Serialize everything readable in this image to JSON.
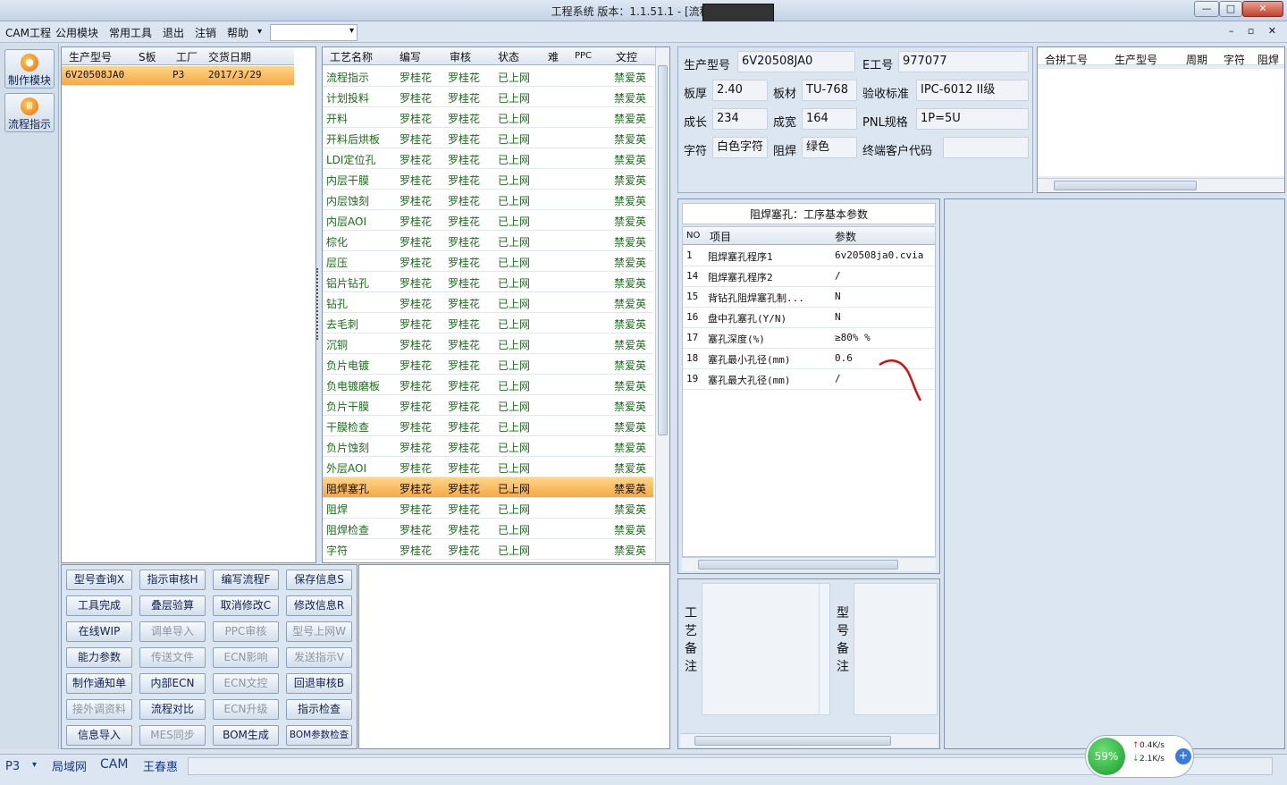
{
  "window": {
    "title": "工程系统    版本：1.1.51.1 - [流程指示]",
    "btn_minimize": "—",
    "btn_maximize": "□",
    "btn_close": "✕"
  },
  "menu": {
    "items": [
      "CAM工程",
      "公用模块",
      "常用工具",
      "退出",
      "注销",
      "帮助"
    ],
    "help_arrow": "▾",
    "mdi_controls": "– ▫ ✕"
  },
  "sidebar": {
    "buttons": [
      {
        "label": "制作模块"
      },
      {
        "label": "流程指示"
      }
    ]
  },
  "product_list": {
    "columns": [
      "生产型号",
      "S板",
      "工厂",
      "交货日期"
    ],
    "rows": [
      {
        "model": "6V20508JA0",
        "s": "",
        "factory": "P3",
        "date": "2017/3/29"
      }
    ]
  },
  "process_list": {
    "columns": [
      "工艺名称",
      "编写",
      "审核",
      "状态",
      "难",
      "PPC",
      "文控"
    ],
    "rows": [
      {
        "name": "流程指示",
        "writer": "罗桂花",
        "reviewer": "罗桂花",
        "status": "已上网",
        "control": "禁爱英"
      },
      {
        "name": "计划投料",
        "writer": "罗桂花",
        "reviewer": "罗桂花",
        "status": "已上网",
        "control": "禁爱英"
      },
      {
        "name": "开料",
        "writer": "罗桂花",
        "reviewer": "罗桂花",
        "status": "已上网",
        "control": "禁爱英"
      },
      {
        "name": "开料后烘板",
        "writer": "罗桂花",
        "reviewer": "罗桂花",
        "status": "已上网",
        "control": "禁爱英"
      },
      {
        "name": "LDI定位孔",
        "writer": "罗桂花",
        "reviewer": "罗桂花",
        "status": "已上网",
        "control": "禁爱英"
      },
      {
        "name": "内层干膜",
        "writer": "罗桂花",
        "reviewer": "罗桂花",
        "status": "已上网",
        "control": "禁爱英"
      },
      {
        "name": "内层蚀刻",
        "writer": "罗桂花",
        "reviewer": "罗桂花",
        "status": "已上网",
        "control": "禁爱英"
      },
      {
        "name": "内层AOI",
        "writer": "罗桂花",
        "reviewer": "罗桂花",
        "status": "已上网",
        "control": "禁爱英"
      },
      {
        "name": "棕化",
        "writer": "罗桂花",
        "reviewer": "罗桂花",
        "status": "已上网",
        "control": "禁爱英"
      },
      {
        "name": "层压",
        "writer": "罗桂花",
        "reviewer": "罗桂花",
        "status": "已上网",
        "control": "禁爱英"
      },
      {
        "name": "铝片钻孔",
        "writer": "罗桂花",
        "reviewer": "罗桂花",
        "status": "已上网",
        "control": "禁爱英"
      },
      {
        "name": "钻孔",
        "writer": "罗桂花",
        "reviewer": "罗桂花",
        "status": "已上网",
        "control": "禁爱英"
      },
      {
        "name": "去毛刺",
        "writer": "罗桂花",
        "reviewer": "罗桂花",
        "status": "已上网",
        "control": "禁爱英"
      },
      {
        "name": "沉铜",
        "writer": "罗桂花",
        "reviewer": "罗桂花",
        "status": "已上网",
        "control": "禁爱英"
      },
      {
        "name": "负片电镀",
        "writer": "罗桂花",
        "reviewer": "罗桂花",
        "status": "已上网",
        "control": "禁爱英"
      },
      {
        "name": "负电镀磨板",
        "writer": "罗桂花",
        "reviewer": "罗桂花",
        "status": "已上网",
        "control": "禁爱英"
      },
      {
        "name": "负片干膜",
        "writer": "罗桂花",
        "reviewer": "罗桂花",
        "status": "已上网",
        "control": "禁爱英"
      },
      {
        "name": "干膜检查",
        "writer": "罗桂花",
        "reviewer": "罗桂花",
        "status": "已上网",
        "control": "禁爱英"
      },
      {
        "name": "负片蚀刻",
        "writer": "罗桂花",
        "reviewer": "罗桂花",
        "status": "已上网",
        "control": "禁爱英"
      },
      {
        "name": "外层AOI",
        "writer": "罗桂花",
        "reviewer": "罗桂花",
        "status": "已上网",
        "control": "禁爱英"
      },
      {
        "name": "阻焊塞孔",
        "writer": "罗桂花",
        "reviewer": "罗桂花",
        "status": "已上网",
        "control": "禁爱英",
        "selected": true
      },
      {
        "name": "阻焊",
        "writer": "罗桂花",
        "reviewer": "罗桂花",
        "status": "已上网",
        "control": "禁爱英"
      },
      {
        "name": "阻焊检查",
        "writer": "罗桂花",
        "reviewer": "罗桂花",
        "status": "已上网",
        "control": "禁爱英"
      },
      {
        "name": "字符",
        "writer": "罗桂花",
        "reviewer": "罗桂花",
        "status": "已上网",
        "control": "禁爱英"
      }
    ]
  },
  "actions": {
    "buttons": [
      {
        "label": "型号查询X",
        "enabled": true
      },
      {
        "label": "指示审核H",
        "enabled": true
      },
      {
        "label": "编写流程F",
        "enabled": true
      },
      {
        "label": "保存信息S",
        "enabled": true
      },
      {
        "label": "工具完成",
        "enabled": true
      },
      {
        "label": "叠层验算",
        "enabled": true
      },
      {
        "label": "取消修改C",
        "enabled": true
      },
      {
        "label": "修改信息R",
        "enabled": true
      },
      {
        "label": "在线WIP",
        "enabled": true
      },
      {
        "label": "调单导入",
        "enabled": false
      },
      {
        "label": "PPC审核",
        "enabled": false
      },
      {
        "label": "型号上网W",
        "enabled": false
      },
      {
        "label": "能力参数",
        "enabled": true
      },
      {
        "label": "传送文件",
        "enabled": false
      },
      {
        "label": "ECN影响",
        "enabled": false
      },
      {
        "label": "发送指示V",
        "enabled": false
      },
      {
        "label": "制作通知单",
        "enabled": true
      },
      {
        "label": "内部ECN",
        "enabled": true
      },
      {
        "label": "ECN文控",
        "enabled": false
      },
      {
        "label": "回退审核B",
        "enabled": true
      },
      {
        "label": "接外调资料",
        "enabled": false
      },
      {
        "label": "流程对比",
        "enabled": true
      },
      {
        "label": "ECN升级",
        "enabled": false
      },
      {
        "label": "指示检查",
        "enabled": true
      },
      {
        "label": "信息导入",
        "enabled": true
      },
      {
        "label": "MES同步",
        "enabled": false
      },
      {
        "label": "BOM生成",
        "enabled": true
      },
      {
        "label": "BOM参数检查",
        "enabled": true
      }
    ]
  },
  "info": {
    "model_label": "生产型号",
    "model": "6V20508JA0",
    "e_label": "E工号",
    "e_no": "977077",
    "thick_label": "板厚",
    "thick": "2.40",
    "material_label": "板材",
    "material": "TU-768",
    "std_label": "验收标准",
    "std": "IPC-6012 II级",
    "len_label": "成长",
    "len": "234",
    "wid_label": "成宽",
    "wid": "164",
    "pnl_label": "PNL规格",
    "pnl": "1P=5U",
    "char_label": "字符",
    "char": "白色字符",
    "mask_label": "阻焊",
    "mask": "绿色",
    "cust_label": "终端客户代码",
    "cust": ""
  },
  "merge": {
    "columns": [
      "合拼工号",
      "生产型号",
      "周期",
      "字符",
      "阻焊"
    ]
  },
  "params": {
    "title": "阻焊塞孔：工序基本参数",
    "columns": [
      "NO",
      "项目",
      "参数"
    ],
    "rows": [
      {
        "no": "1",
        "item": "阻焊塞孔程序1",
        "value": "6v20508ja0.cvia"
      },
      {
        "no": "14",
        "item": "阻焊塞孔程序2",
        "value": "/"
      },
      {
        "no": "15",
        "item": "背钻孔阻焊塞孔制...",
        "value": "N"
      },
      {
        "no": "16",
        "item": "盘中孔塞孔(Y/N)",
        "value": "N"
      },
      {
        "no": "17",
        "item": "塞孔深度(%)",
        "value": "≥80% %"
      },
      {
        "no": "18",
        "item": "塞孔最小孔径(mm)",
        "value": "0.6"
      },
      {
        "no": "19",
        "item": "塞孔最大孔径(mm)",
        "value": "/"
      }
    ]
  },
  "remarks": {
    "process_label": "工艺备注",
    "model_label": "型号备注"
  },
  "status": {
    "factory": "P3",
    "net": "局域网",
    "dept": "CAM",
    "user": "王春惠",
    "cpu": "59%",
    "up": "0.4K/s",
    "down": "2.1K/s",
    "up_arrow": "↑",
    "down_arrow": "↓",
    "plus": "+"
  },
  "colors": {
    "accent_selected": "#f5a944",
    "cell_text": "#1a6e1a",
    "annotation": "#cc1111"
  }
}
